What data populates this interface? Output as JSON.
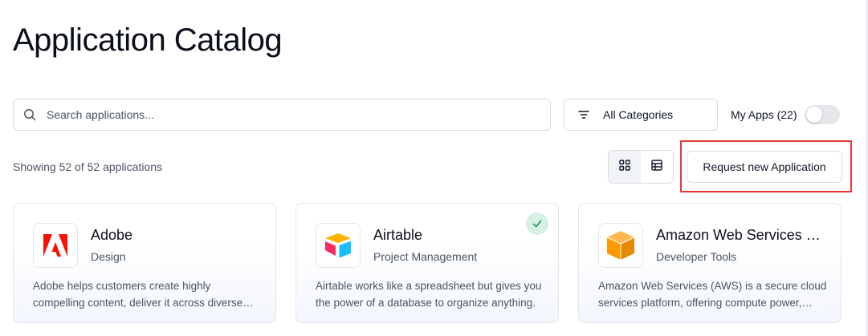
{
  "page": {
    "title": "Application Catalog"
  },
  "search": {
    "placeholder": "Search applications...",
    "icon": "search-icon"
  },
  "filters": {
    "category_label": "All Categories",
    "category_icon": "filter-icon",
    "my_apps_label": "My Apps (22)",
    "my_apps_enabled": false
  },
  "results": {
    "count_text": "Showing 52 of 52 applications"
  },
  "view": {
    "active": "grid",
    "options": [
      "grid",
      "table"
    ]
  },
  "actions": {
    "request_label": "Request new Application"
  },
  "apps": [
    {
      "name": "Adobe",
      "category": "Design",
      "description": "Adobe helps customers create highly compelling content, deliver it across diverse channels and devices.",
      "icon": "adobe-logo-icon",
      "installed": false
    },
    {
      "name": "Airtable",
      "category": "Project Management",
      "description": "Airtable works like a spreadsheet but gives you the power of a database to organize anything.",
      "icon": "airtable-logo-icon",
      "installed": true
    },
    {
      "name": "Amazon Web Services (AWS)",
      "category": "Developer Tools",
      "description": "Amazon Web Services (AWS) is a secure cloud services platform, offering compute power, database storage, content delivery and more.",
      "icon": "aws-logo-icon",
      "installed": false
    }
  ],
  "colors": {
    "highlight": "#e53935",
    "adobe_red": "#fa0f00",
    "installed_badge_bg": "#d6f0e3",
    "installed_badge_fg": "#2e9e6a",
    "aws_orange": "#ff9900"
  }
}
